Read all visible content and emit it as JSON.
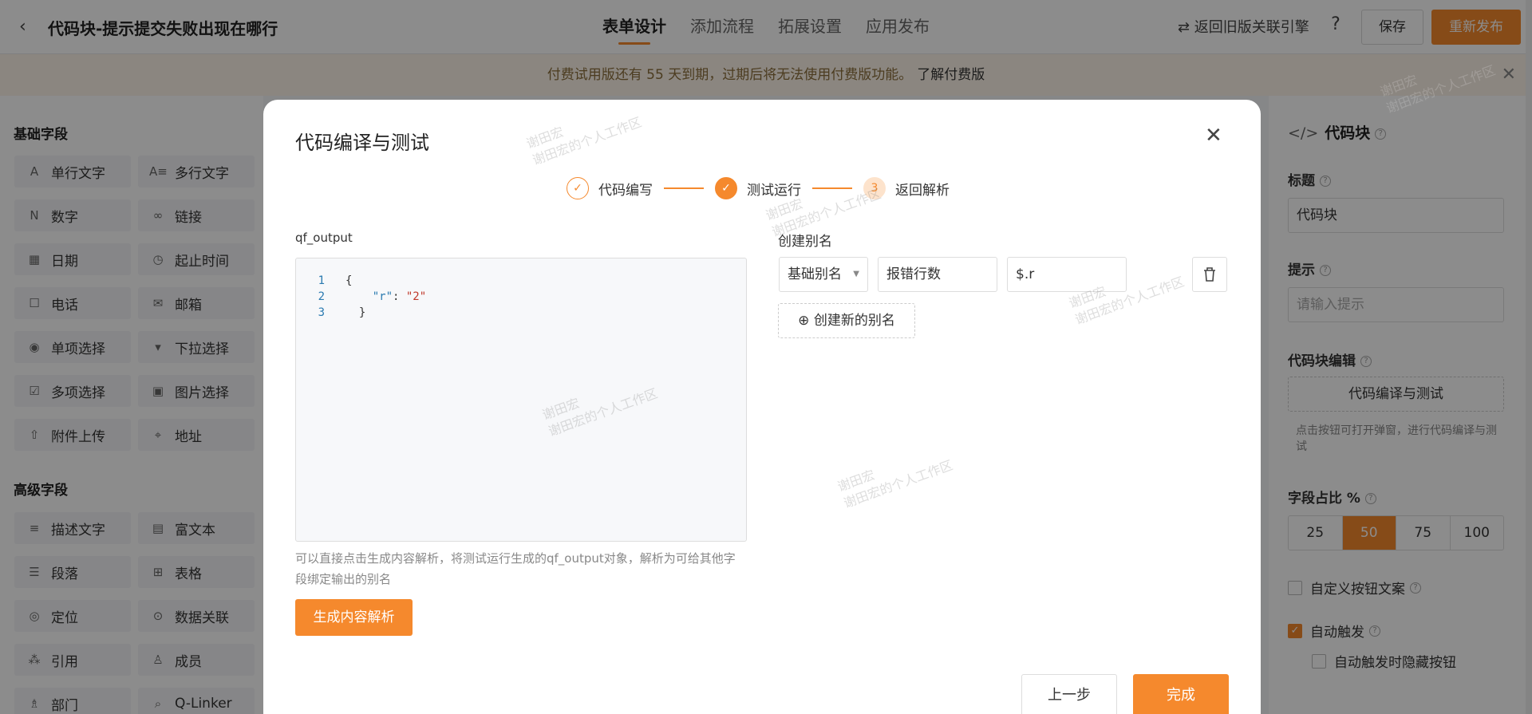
{
  "header": {
    "back_icon": "chevron-left-icon",
    "title": "代码块-提示提交失败出现在哪行",
    "tabs": [
      "表单设计",
      "添加流程",
      "拓展设置",
      "应用发布"
    ],
    "active_tab": "表单设计",
    "old_engine": "⇄ 返回旧版关联引擎",
    "help": "?",
    "save": "保存",
    "republish": "重新发布"
  },
  "notice": {
    "text": "付费试用版还有 55 天到期，过期后将无法使用付费版功能。",
    "link": "了解付费版",
    "close": "✕"
  },
  "sidebar": {
    "basic_title": "基础字段",
    "basic_fields": [
      {
        "icon": "A",
        "label": "单行文字"
      },
      {
        "icon": "A≡",
        "label": "多行文字"
      },
      {
        "icon": "N",
        "label": "数字"
      },
      {
        "icon": "∞",
        "label": "链接"
      },
      {
        "icon": "▦",
        "label": "日期"
      },
      {
        "icon": "◷",
        "label": "起止时间"
      },
      {
        "icon": "☐",
        "label": "电话"
      },
      {
        "icon": "✉",
        "label": "邮箱"
      },
      {
        "icon": "◉",
        "label": "单项选择"
      },
      {
        "icon": "▾",
        "label": "下拉选择"
      },
      {
        "icon": "☑",
        "label": "多项选择"
      },
      {
        "icon": "▣",
        "label": "图片选择"
      },
      {
        "icon": "⇧",
        "label": "附件上传"
      },
      {
        "icon": "⌖",
        "label": "地址"
      }
    ],
    "advanced_title": "高级字段",
    "advanced_fields": [
      {
        "icon": "≡",
        "label": "描述文字"
      },
      {
        "icon": "▤",
        "label": "富文本"
      },
      {
        "icon": "☰",
        "label": "段落"
      },
      {
        "icon": "⊞",
        "label": "表格"
      },
      {
        "icon": "◎",
        "label": "定位"
      },
      {
        "icon": "⊙",
        "label": "数据关联"
      },
      {
        "icon": "⁂",
        "label": "引用"
      },
      {
        "icon": "♙",
        "label": "成员"
      },
      {
        "icon": "♗",
        "label": "部门"
      },
      {
        "icon": "⌕",
        "label": "Q-Linker"
      }
    ]
  },
  "right_panel": {
    "title": "代码块",
    "title_label": "标题",
    "title_value": "代码块",
    "hint_label": "提示",
    "hint_placeholder": "请输入提示",
    "code_label": "代码块编辑",
    "code_button": "代码编译与测试",
    "code_hint": "点击按钮可打开弹窗，进行代码编译与测试",
    "ratio_label": "字段占比 %",
    "ratio_options": [
      "25",
      "50",
      "75",
      "100"
    ],
    "ratio_selected": "50",
    "custom_btn_text": "自定义按钮文案",
    "auto_trigger": "自动触发",
    "auto_hide": "自动触发时隐藏按钮",
    "custom_btn_checked": false,
    "auto_trigger_checked": true,
    "auto_hide_checked": false
  },
  "modal": {
    "title": "代码编译与测试",
    "close": "✕",
    "steps": [
      {
        "label": "代码编写",
        "state": "done"
      },
      {
        "label": "测试运行",
        "state": "active"
      },
      {
        "label": "返回解析",
        "state": "pending",
        "number": "3"
      }
    ],
    "output_label": "qf_output",
    "code_lines": [
      "1",
      "2",
      "3"
    ],
    "code_key": "\"r\"",
    "code_value": "\"2\"",
    "help_text": "可以直接点击生成内容解析，将测试运行生成的qf_output对象，解析为可给其他字段绑定输出的别名",
    "generate_button": "生成内容解析",
    "alias_title": "创建别名",
    "alias_type": "基础别名",
    "alias_name": "报错行数",
    "alias_path": "$.r",
    "add_alias": "⊕ 创建新的别名",
    "prev_button": "上一步",
    "done_button": "完成"
  },
  "watermark": {
    "name": "谢田宏",
    "workspace": "谢田宏的个人工作区"
  },
  "colors": {
    "accent": "#f5892d",
    "overlay": "rgba(0,0,0,0.45)"
  }
}
